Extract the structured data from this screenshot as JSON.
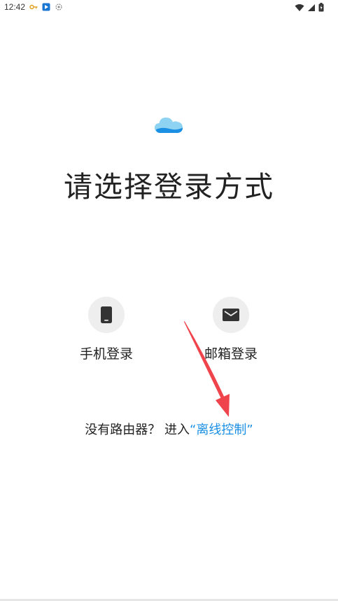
{
  "status_bar": {
    "time": "12:42",
    "notification_icons": [
      "key-icon",
      "app-notification-icon",
      "sync-icon"
    ],
    "system_icons": [
      "wifi-icon",
      "cellular-signal-icon",
      "battery-icon"
    ]
  },
  "logo": {
    "icon": "cloud-logo-icon",
    "color": "#29a8e0"
  },
  "title": "请选择登录方式",
  "login_options": [
    {
      "label": "手机登录",
      "icon": "phone-icon"
    },
    {
      "label": "邮箱登录",
      "icon": "mail-icon"
    }
  ],
  "offline": {
    "prefix": "没有路由器？ 进入",
    "link_text": "“离线控制”",
    "link_color": "#1a8fe3"
  },
  "annotation": {
    "arrow_color": "#f0444c"
  }
}
